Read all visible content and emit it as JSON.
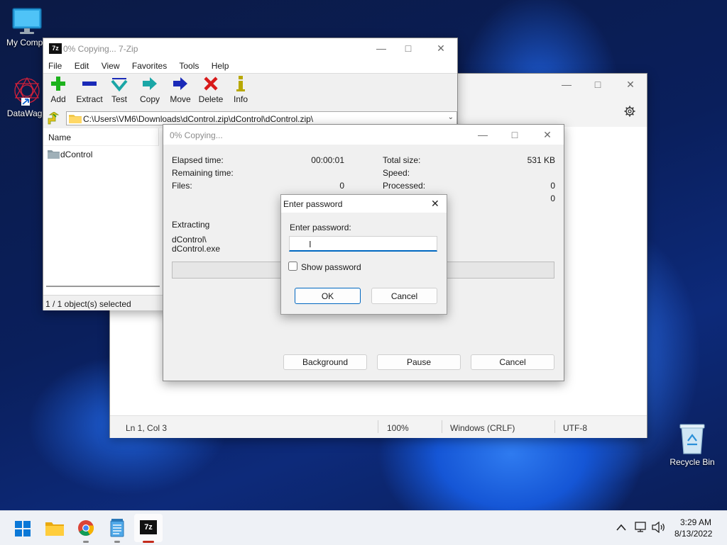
{
  "desktop": {
    "icons": [
      {
        "label": "My Compu"
      },
      {
        "label": "DataWago"
      },
      {
        "label": "Recycle Bin"
      }
    ]
  },
  "sevenzip": {
    "title": "0% Copying... 7-Zip",
    "menu": [
      "File",
      "Edit",
      "View",
      "Favorites",
      "Tools",
      "Help"
    ],
    "toolbar": [
      {
        "label": "Add",
        "icon": "plus-icon",
        "color": "#1db21d"
      },
      {
        "label": "Extract",
        "icon": "minus-icon",
        "color": "#1a2ab8"
      },
      {
        "label": "Test",
        "icon": "check-icon",
        "color": "#1aa6a6"
      },
      {
        "label": "Copy",
        "icon": "arrow-right-icon",
        "color": "#1aa6a6"
      },
      {
        "label": "Move",
        "icon": "arrow-right-icon",
        "color": "#1a2ab8"
      },
      {
        "label": "Delete",
        "icon": "x-icon",
        "color": "#d81a1a"
      },
      {
        "label": "Info",
        "icon": "info-icon",
        "color": "#b8a800"
      }
    ],
    "address": "C:\\Users\\VM6\\Downloads\\dControl.zip\\dControl\\dControl.zip\\",
    "column_name": "Name",
    "files": [
      {
        "name": "dControl"
      }
    ],
    "status": "1 / 1 object(s) selected"
  },
  "notepad": {
    "status": {
      "position": "Ln 1, Col 3",
      "zoom": "100%",
      "line_ending": "Windows (CRLF)",
      "encoding": "UTF-8"
    }
  },
  "copying": {
    "title": "0% Copying...",
    "stats_left": [
      {
        "label": "Elapsed time:",
        "value": "00:00:01"
      },
      {
        "label": "Remaining time:",
        "value": ""
      },
      {
        "label": "Files:",
        "value": "0"
      }
    ],
    "stats_right": [
      {
        "label": "Total size:",
        "value": "531 KB"
      },
      {
        "label": "Speed:",
        "value": ""
      },
      {
        "label": "Processed:",
        "value": "0"
      },
      {
        "label": "",
        "value": "0"
      }
    ],
    "operation": "Extracting",
    "current_path": "dControl\\",
    "current_file": "dControl.exe",
    "progress": 0,
    "buttons": {
      "background": "Background",
      "pause": "Pause",
      "cancel": "Cancel"
    }
  },
  "password_dialog": {
    "title": "Enter password",
    "prompt": "Enter password:",
    "value": "",
    "show_password_label": "Show password",
    "show_password_checked": false,
    "ok_label": "OK",
    "cancel_label": "Cancel"
  },
  "taskbar": {
    "time": "3:29 AM",
    "date": "8/13/2022",
    "accent": "#0067c0"
  }
}
